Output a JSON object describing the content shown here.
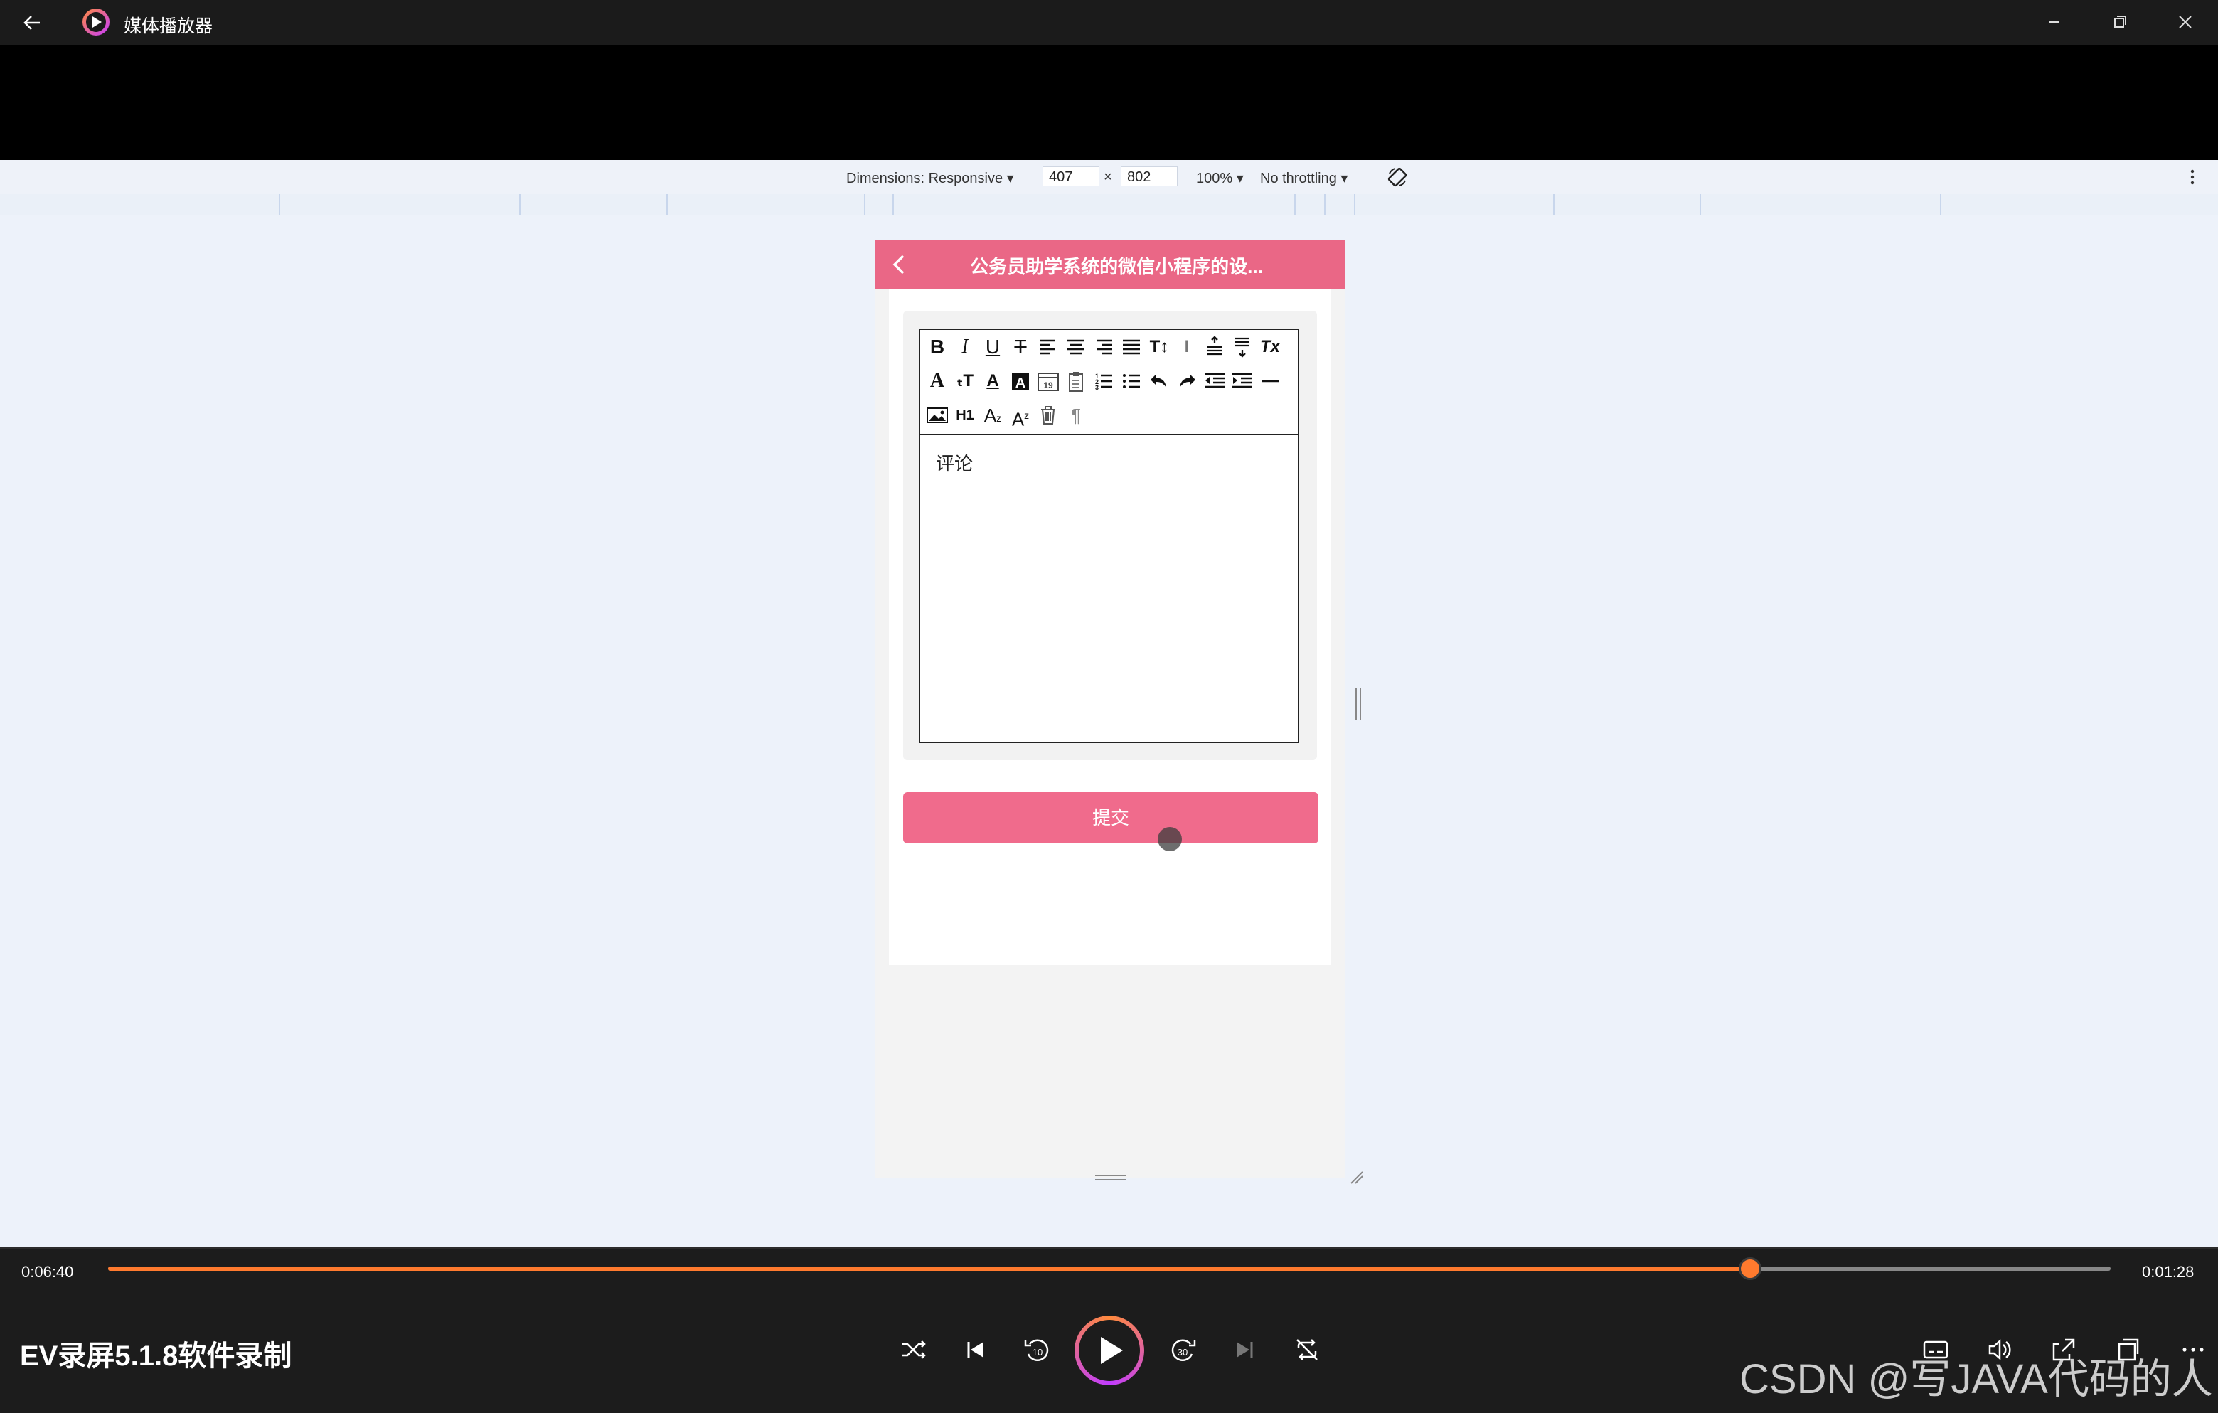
{
  "window": {
    "title": "媒体播放器"
  },
  "devtools": {
    "dimensions_label": "Dimensions: Responsive",
    "width": "407",
    "times": "×",
    "height": "802",
    "zoom": "100%",
    "throttling": "No throttling"
  },
  "phone": {
    "nav_title": "公务员助学系统的微信小程序的设...",
    "editor_text": "评论",
    "submit_label": "提交"
  },
  "player": {
    "elapsed": "0:06:40",
    "remaining": "0:01:28",
    "progress": 0.82,
    "filename": "EV录屏5.1.8软件录制",
    "watermark": "CSDN @写JAVA代码的人",
    "accent": "#ff7a2e"
  },
  "icons": {
    "toolbar_row1": [
      "bold-icon",
      "italic-icon",
      "underline-icon",
      "strikethrough-icon",
      "align-left-icon",
      "align-center-icon",
      "align-right-icon",
      "align-justify-icon",
      "font-size-icon",
      "line-height-icon",
      "space-before-icon",
      "space-after-icon",
      "clear-format-icon"
    ],
    "toolbar_row2": [
      "font-icon",
      "text-size-icon",
      "font-color-icon",
      "background-color-icon",
      "date-icon",
      "paste-icon",
      "ordered-list-icon",
      "unordered-list-icon",
      "undo-icon",
      "redo-icon",
      "outdent-icon",
      "indent-icon",
      "horizontal-rule-icon"
    ],
    "toolbar_row3": [
      "image-icon",
      "heading-icon",
      "subscript-icon",
      "superscript-icon",
      "delete-icon",
      "paragraph-icon"
    ]
  }
}
